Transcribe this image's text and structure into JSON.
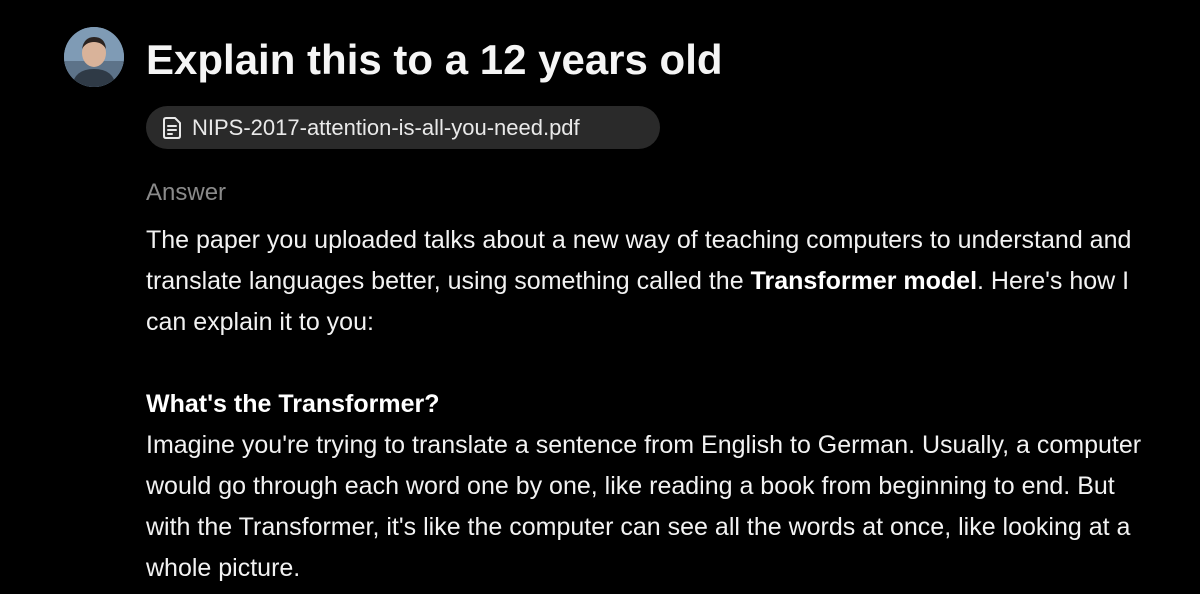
{
  "prompt": {
    "title": "Explain this to a 12 years old",
    "attachment": {
      "filename": "NIPS-2017-attention-is-all-you-need.pdf",
      "icon": "document-icon"
    }
  },
  "answer": {
    "label": "Answer",
    "intro_before": "The paper you uploaded talks about a new way of teaching computers to understand and translate languages better, using something called the ",
    "intro_bold": "Transformer model",
    "intro_after": ". Here's how I can explain it to you:",
    "section_heading": "What's the Transformer?",
    "section_text": "Imagine you're trying to translate a sentence from English to German. Usually, a computer would go through each word one by one, like reading a book from beginning to end. But with the Transformer, it's like the computer can see all the words at once, like looking at a whole picture."
  },
  "colors": {
    "background": "#000000",
    "text": "#f2f2f2",
    "muted": "#8a8a8a",
    "chip_background": "#2a2a2a"
  }
}
